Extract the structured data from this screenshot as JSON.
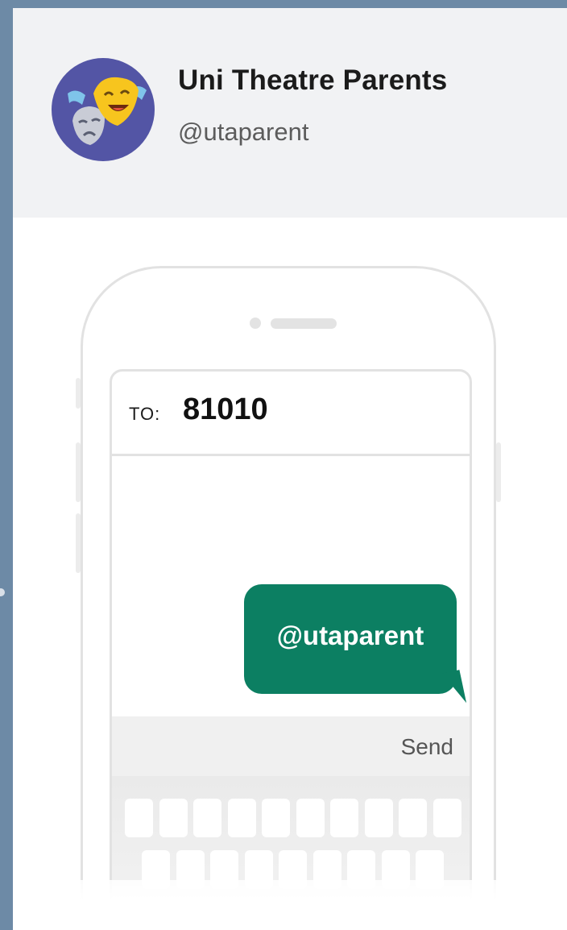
{
  "profile": {
    "name": "Uni Theatre Parents",
    "handle": "@utaparent",
    "avatar_icon": "theatre-masks-icon"
  },
  "message": {
    "to_label": "TO:",
    "to_number": "81010",
    "bubble_text": "@utaparent",
    "send_label": "Send"
  },
  "colors": {
    "page_background": "#6d8aa6",
    "header_background": "#f1f2f4",
    "avatar_background": "#5355a5",
    "bubble": "#0c7f62"
  }
}
